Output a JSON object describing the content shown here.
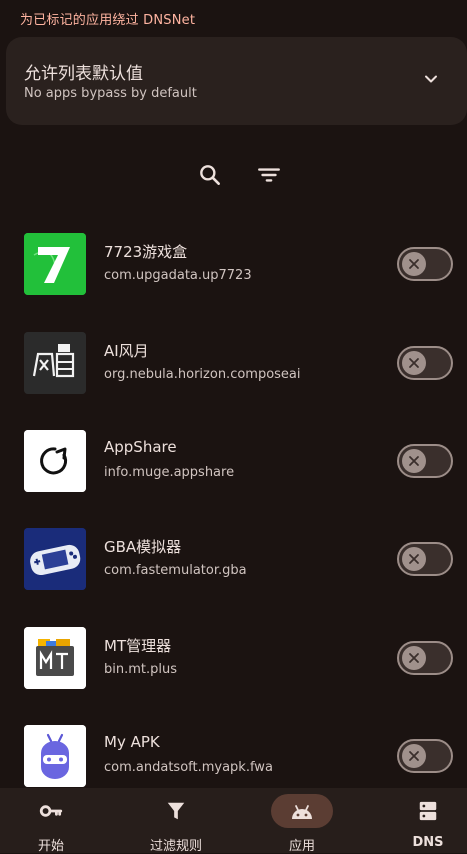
{
  "header": {
    "note": "为已标记的应用绕过 DNSNet"
  },
  "allowlist_card": {
    "title": "允许列表默认值",
    "subtitle": "No apps bypass by default",
    "chevron_icon": "chevron-down-icon"
  },
  "toolbar": {
    "search_icon": "search-icon",
    "filter_icon": "filter-icon"
  },
  "apps": [
    {
      "name": "7723游戏盒",
      "package": "com.upgadata.up7723",
      "icon": "7723-app-icon",
      "bypass": false
    },
    {
      "name": "AI风月",
      "package": "org.nebula.horizon.composeai",
      "icon": "ai-fengyue-app-icon",
      "bypass": false
    },
    {
      "name": "AppShare",
      "package": "info.muge.appshare",
      "icon": "appshare-app-icon",
      "bypass": false
    },
    {
      "name": "GBA模拟器",
      "package": "com.fastemulator.gba",
      "icon": "gba-emulator-app-icon",
      "bypass": false
    },
    {
      "name": "MT管理器",
      "package": "bin.mt.plus",
      "icon": "mt-manager-app-icon",
      "bypass": false
    },
    {
      "name": "My APK",
      "package": "com.andatsoft.myapk.fwa",
      "icon": "my-apk-app-icon",
      "bypass": false
    }
  ],
  "bottom_nav": [
    {
      "label": "开始",
      "icon": "key-icon",
      "active": false
    },
    {
      "label": "过滤规则",
      "icon": "filter-funnel-icon",
      "active": false
    },
    {
      "label": "应用",
      "icon": "android-icon",
      "active": true
    },
    {
      "label": "DNS",
      "icon": "dns-server-icon",
      "active": false
    }
  ],
  "colors": {
    "background": "#1b1311",
    "accent": "#ffb4a1",
    "card": "#2a211e",
    "active_pill": "#5b3d33"
  }
}
